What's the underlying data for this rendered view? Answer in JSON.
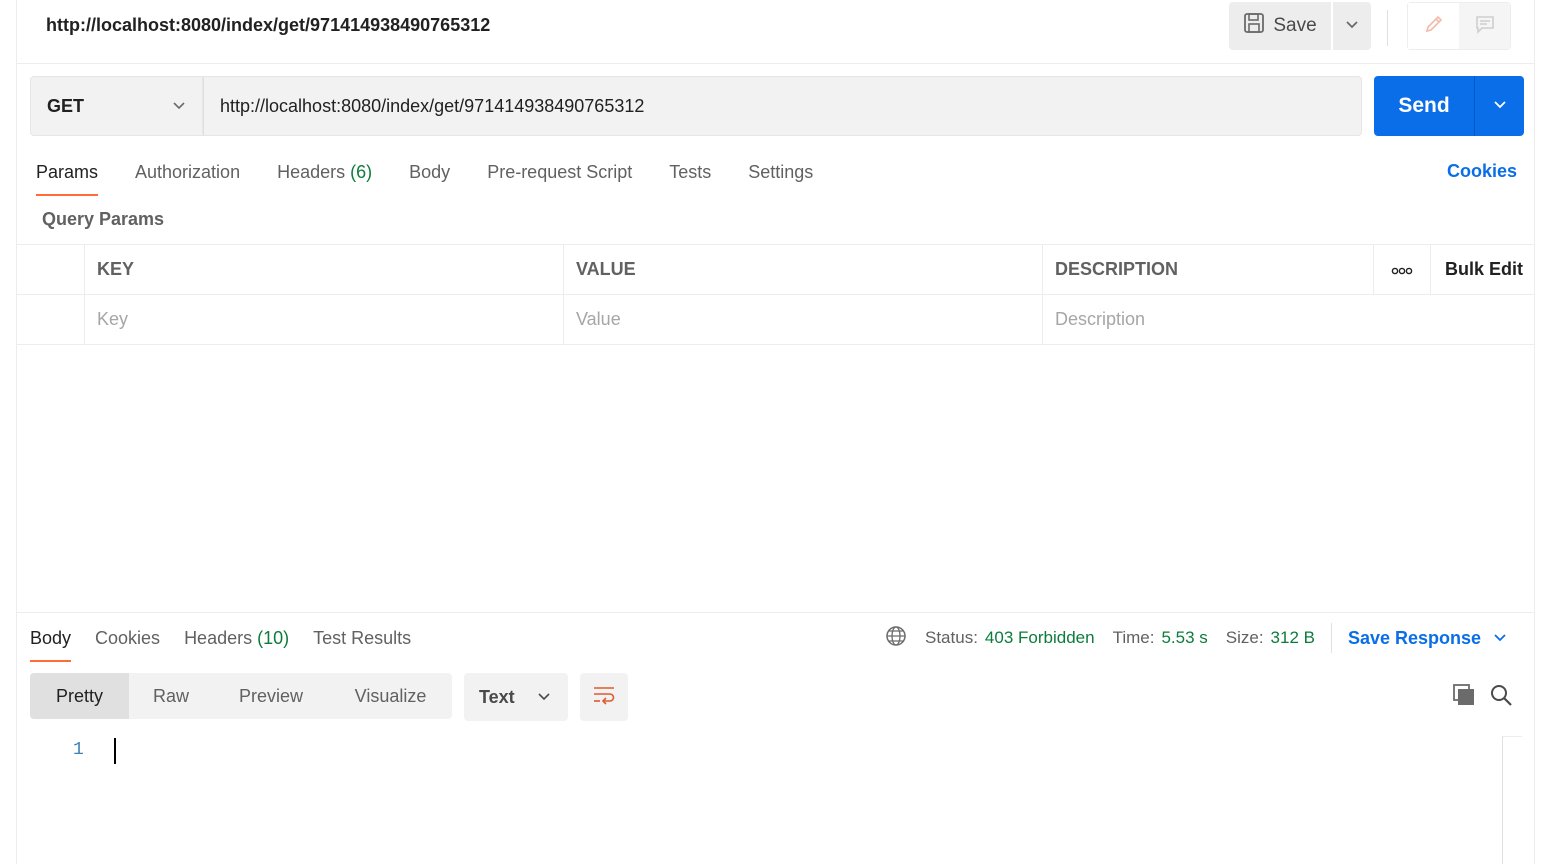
{
  "header": {
    "title": "http://localhost:8080/index/get/971414938490765312",
    "save_label": "Save"
  },
  "request": {
    "method": "GET",
    "url": "http://localhost:8080/index/get/971414938490765312",
    "send_label": "Send"
  },
  "request_tabs": [
    {
      "label": "Params",
      "count": ""
    },
    {
      "label": "Authorization",
      "count": ""
    },
    {
      "label": "Headers",
      "count": "(6)"
    },
    {
      "label": "Body",
      "count": ""
    },
    {
      "label": "Pre-request Script",
      "count": ""
    },
    {
      "label": "Tests",
      "count": ""
    },
    {
      "label": "Settings",
      "count": ""
    }
  ],
  "cookies_label": "Cookies",
  "query_params": {
    "title": "Query Params",
    "columns": {
      "key": "KEY",
      "value": "VALUE",
      "description": "DESCRIPTION",
      "bulk_edit": "Bulk Edit"
    },
    "placeholders": {
      "key": "Key",
      "value": "Value",
      "description": "Description"
    }
  },
  "response": {
    "tabs": [
      {
        "label": "Body",
        "count": ""
      },
      {
        "label": "Cookies",
        "count": ""
      },
      {
        "label": "Headers",
        "count": "(10)"
      },
      {
        "label": "Test Results",
        "count": ""
      }
    ],
    "status_label": "Status:",
    "status_value": "403 Forbidden",
    "time_label": "Time:",
    "time_value": "5.53 s",
    "size_label": "Size:",
    "size_value": "312 B",
    "save_response_label": "Save Response",
    "views": [
      "Pretty",
      "Raw",
      "Preview",
      "Visualize"
    ],
    "format": "Text",
    "line_number": "1"
  },
  "colors": {
    "accent": "#0a6ee8",
    "active_tab_underline": "#ff6c37",
    "count_green": "#0c7c3b"
  }
}
